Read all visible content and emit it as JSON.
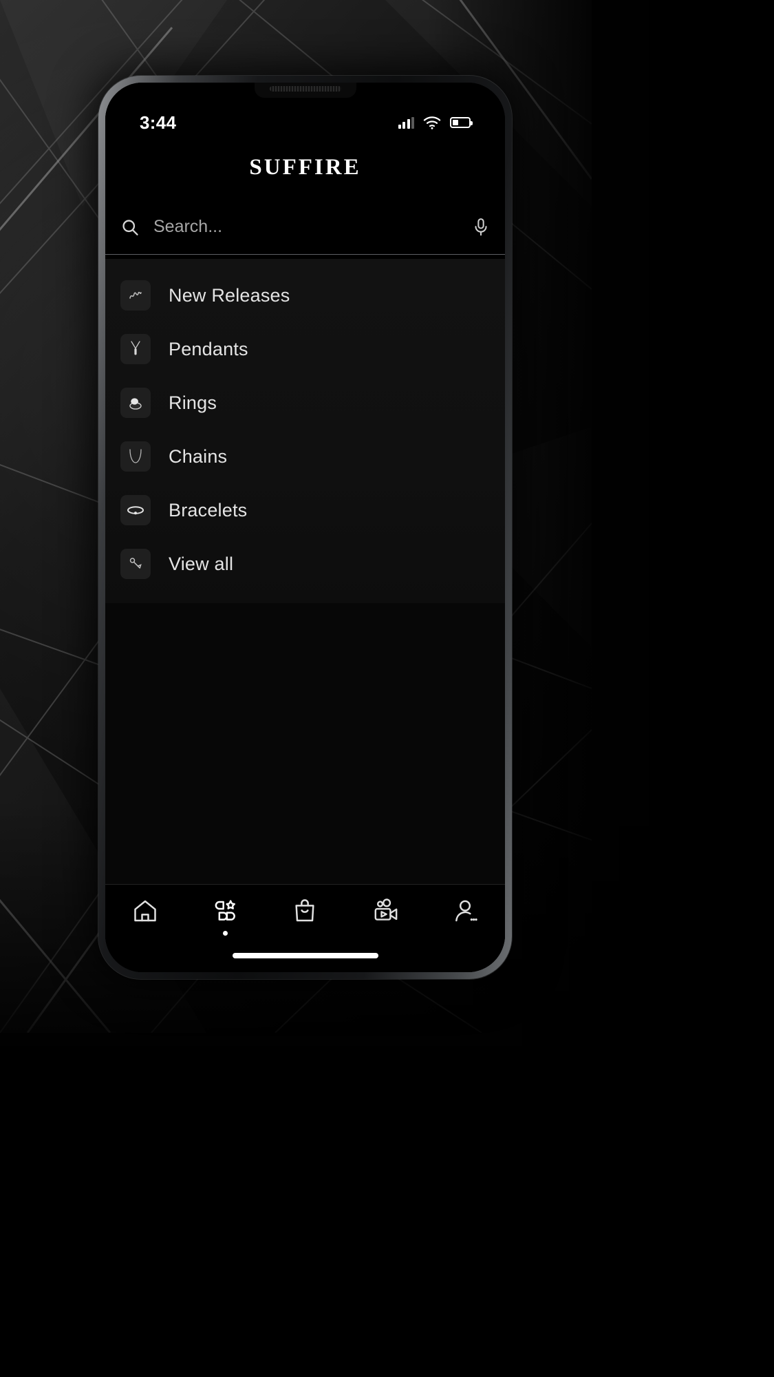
{
  "statusbar": {
    "clock": "3:44",
    "signal_icon": "cellular-signal-icon",
    "wifi_icon": "wifi-icon",
    "battery_icon": "battery-low-icon"
  },
  "header": {
    "app_title": "SUFFIRE"
  },
  "search": {
    "placeholder": "Search...",
    "value": "",
    "search_icon": "search-icon",
    "mic_icon": "microphone-icon"
  },
  "categories": [
    {
      "label": "New Releases",
      "icon": "sparkle-new-icon"
    },
    {
      "label": "Pendants",
      "icon": "pendant-icon"
    },
    {
      "label": "Rings",
      "icon": "ring-icon"
    },
    {
      "label": "Chains",
      "icon": "chain-necklace-icon"
    },
    {
      "label": "Bracelets",
      "icon": "bracelet-icon"
    },
    {
      "label": "View all",
      "icon": "earring-icon"
    }
  ],
  "bottom_nav": [
    {
      "name": "home",
      "icon": "home-icon",
      "active": false
    },
    {
      "name": "categories",
      "icon": "categories-star-icon",
      "active": true
    },
    {
      "name": "shop",
      "icon": "shopping-bag-icon",
      "active": false
    },
    {
      "name": "videos",
      "icon": "video-camera-icon",
      "active": false
    },
    {
      "name": "profile",
      "icon": "user-profile-icon",
      "active": false
    }
  ],
  "colors": {
    "background": "#000000",
    "surface": "#121212",
    "text_primary": "#e8e8e8",
    "text_muted": "#a6a6a6",
    "divider": "#5e6064",
    "icon_tile": "#1f1f1f"
  }
}
